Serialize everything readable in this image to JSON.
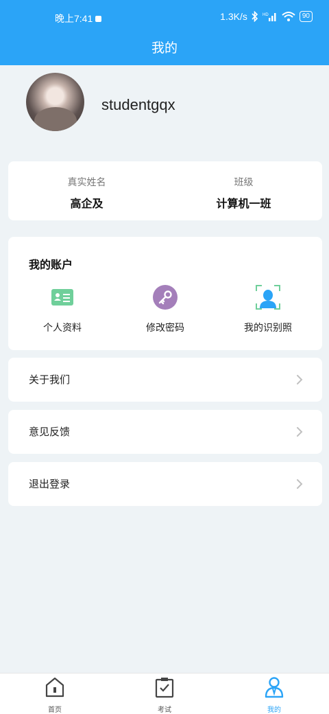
{
  "status_bar": {
    "time": "晚上7:41",
    "net_speed": "1.3K/s",
    "battery": "90"
  },
  "header": {
    "title": "我的"
  },
  "profile": {
    "username": "studentgqx"
  },
  "info": {
    "real_name_label": "真实姓名",
    "real_name_value": "高企及",
    "class_label": "班级",
    "class_value": "计算机一班"
  },
  "account": {
    "title": "我的账户",
    "items": [
      {
        "label": "个人资料",
        "icon": "id-card-icon",
        "color": "#6fcf9a"
      },
      {
        "label": "修改密码",
        "icon": "key-icon",
        "color": "#a47fba"
      },
      {
        "label": "我的识别照",
        "icon": "face-scan-icon",
        "color": "#2ba4f7"
      }
    ]
  },
  "menu": {
    "about": "关于我们",
    "feedback": "意见反馈",
    "logout": "退出登录"
  },
  "tabbar": {
    "home": "首页",
    "exam": "考试",
    "mine": "我的",
    "active_color": "#2ba4f7"
  },
  "colors": {
    "accent": "#2ba4f7",
    "background": "#eef3f6"
  }
}
